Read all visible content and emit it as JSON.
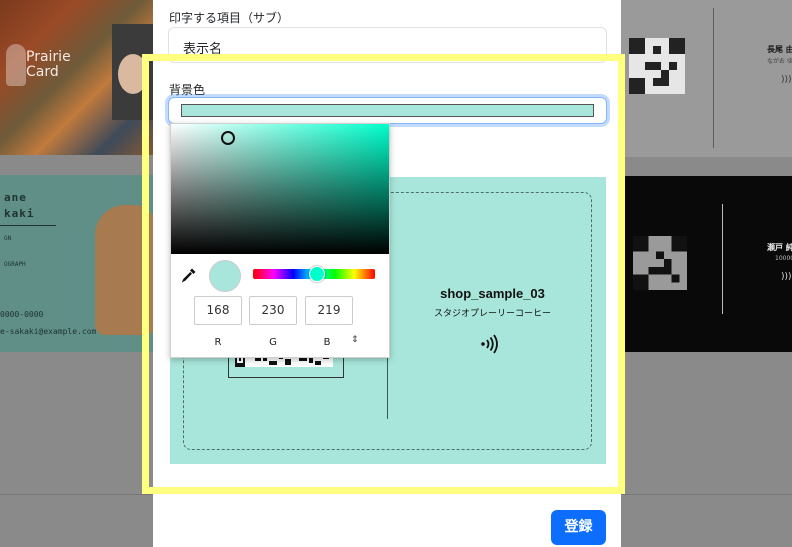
{
  "background": {
    "card_left_top": {
      "brand": "Prairie\nCard"
    },
    "card_left_mid": {
      "name_line1": "ane",
      "name_line2": "kaki",
      "role_line1": "GN",
      "role_line2": "OGRAPH",
      "phone": "0000-0000",
      "email": "e-sakaki@example.com"
    },
    "card_right_top": {
      "name": "長尾 由",
      "name_sub": "ながお ゆ"
    },
    "card_right_mid": {
      "name": "瀬戸 純",
      "name_sub": "10000"
    }
  },
  "form": {
    "sub_label": "印字する項目（サブ）",
    "sub_value": "表示名",
    "bg_color_label": "背景色",
    "bg_color_value": "#a8e6db"
  },
  "preview": {
    "shop_name": "shop_sample_03",
    "shop_subtitle": "スタジオプレーリーコーヒー",
    "background": "#a8e6db",
    "nfc_icon": "nfc-icon"
  },
  "color_picker": {
    "r": "168",
    "g": "230",
    "b": "219",
    "r_label": "R",
    "g_label": "G",
    "b_label": "B",
    "mode_toggle": "⌃⌄",
    "hue_color": "#00ffcc",
    "selected_color": "#a8e6db"
  },
  "actions": {
    "register_label": "登録"
  },
  "colors": {
    "accent": "#0d6efd",
    "highlight": "#ffff80"
  }
}
